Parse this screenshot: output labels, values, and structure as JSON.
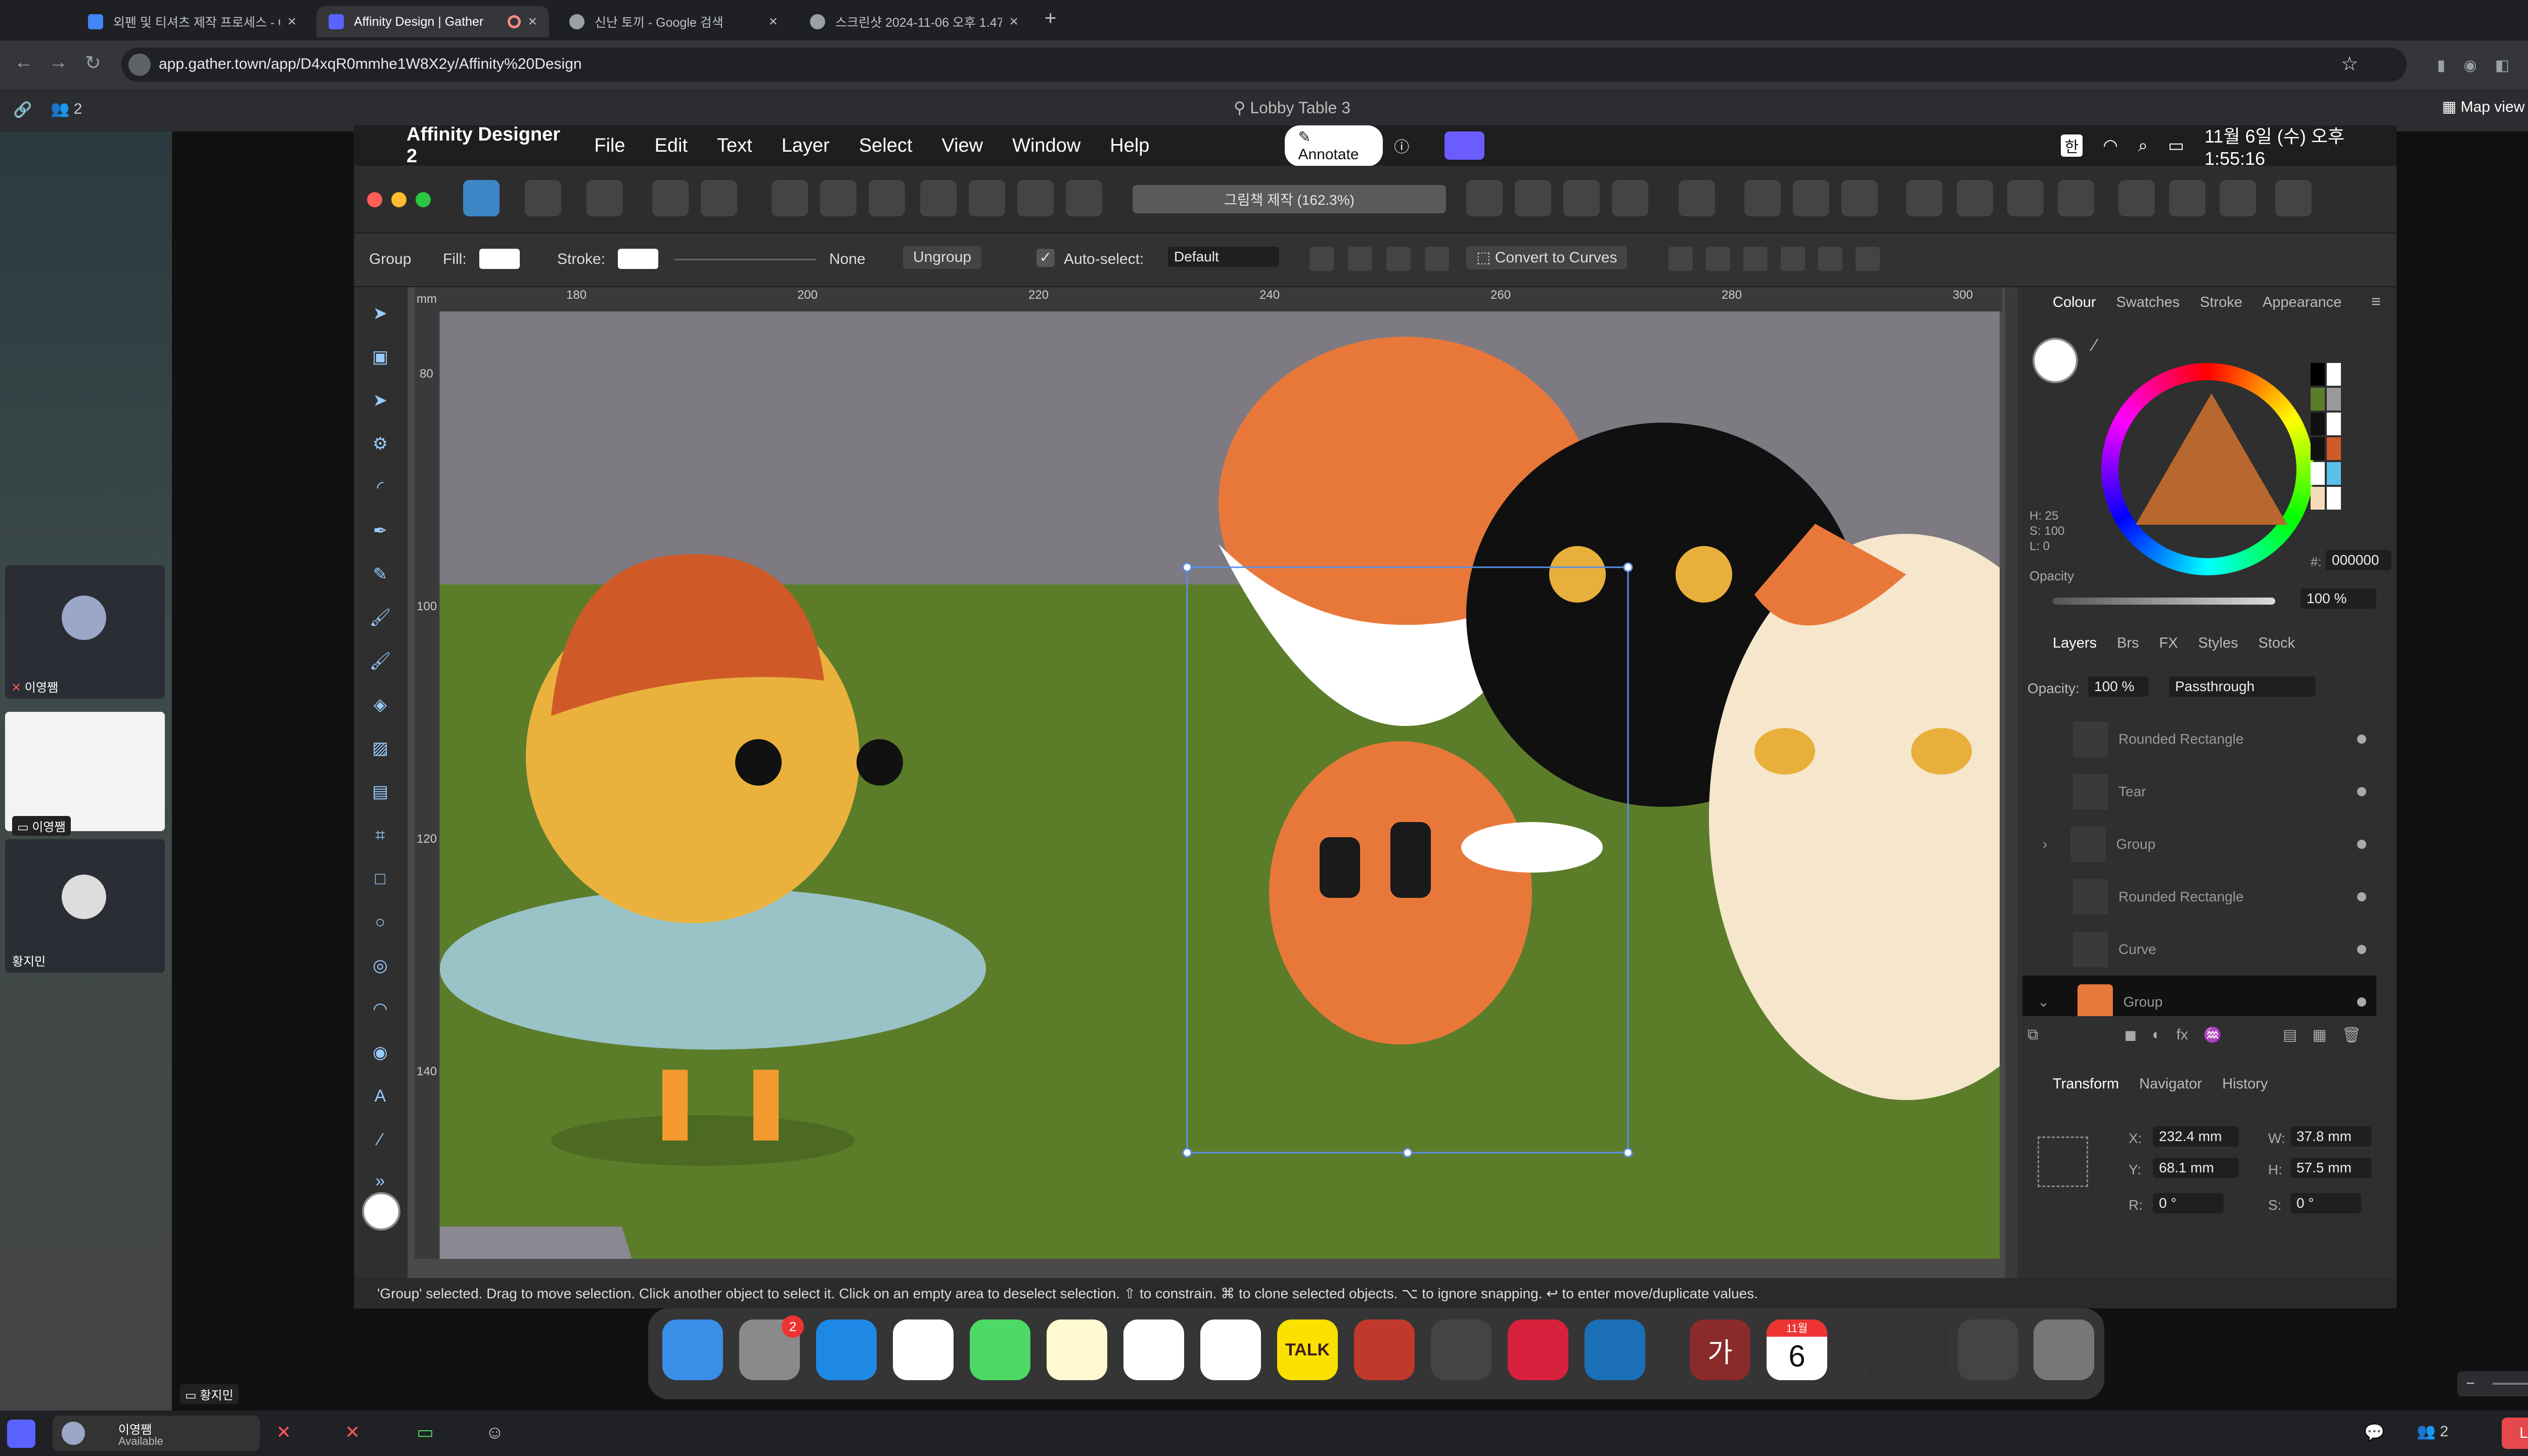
{
  "browser": {
    "tabs": [
      {
        "title": "외펜 및 티셔츠 제작 프로세스 - Go",
        "color": "#4285f4"
      },
      {
        "title": "Affinity Design | Gather",
        "color": "#5a63ff"
      },
      {
        "title": "신난 토끼 - Google 검색",
        "color": "#9aa0a6"
      },
      {
        "title": "스크린샷 2024-11-06 오후 1.47",
        "color": "#9aa0a6"
      }
    ],
    "new_tab": "+",
    "close": "×",
    "url": "app.gather.town/app/D4xqR0mmhe1W8X2y/Affinity%20Design"
  },
  "gather": {
    "participants": "2",
    "location": "Lobby Table 3",
    "map_view": "Map view",
    "tiles": [
      {
        "name": "이영쨈"
      },
      {
        "name": "이영쨈"
      },
      {
        "name": "황지민"
      }
    ],
    "bottom_name": "황지민",
    "user": {
      "name": "이영쨈",
      "status": "Available"
    },
    "leave": "Leave",
    "people_count": "2"
  },
  "mac": {
    "app": "Affinity Designer 2",
    "menus": [
      "File",
      "Edit",
      "Text",
      "Layer",
      "Select",
      "View",
      "Window",
      "Help"
    ],
    "annotate": "Annotate",
    "datetime": "11월 6일 (수) 오후 1:55:16",
    "ime": "한"
  },
  "doc": {
    "title": "그림책 제작 (162.3%)"
  },
  "context": {
    "kind": "Group",
    "fill_label": "Fill:",
    "stroke_label": "Stroke:",
    "stroke_value": "None",
    "ungroup": "Ungroup",
    "autoselect": "Auto-select:",
    "autoselect_value": "Default",
    "convert": "Convert to Curves"
  },
  "ruler": {
    "unit": "mm",
    "h_ticks": [
      "180",
      "200",
      "220",
      "240",
      "260",
      "280",
      "300"
    ],
    "v_ticks": [
      "80",
      "100",
      "120",
      "140"
    ]
  },
  "colour_panel": {
    "tabs": [
      "Colour",
      "Swatches",
      "Stroke",
      "Appearance"
    ],
    "h": "H: 25",
    "s": "S: 100",
    "l": "L: 0",
    "hex_label": "#:",
    "hex": "000000",
    "opacity_label": "Opacity",
    "opacity": "100 %"
  },
  "layers_panel": {
    "tabs": [
      "Layers",
      "Brs",
      "FX",
      "Styles",
      "Stock"
    ],
    "opacity_label": "Opacity:",
    "opacity": "100 %",
    "blend": "Passthrough",
    "rows": [
      "Rounded Rectangle",
      "Tear",
      "Group",
      "Rounded Rectangle",
      "Curve",
      "Group"
    ]
  },
  "transform_panel": {
    "tabs": [
      "Transform",
      "Navigator",
      "History"
    ],
    "x_label": "X:",
    "x": "232.4 mm",
    "y_label": "Y:",
    "y": "68.1 mm",
    "w_label": "W:",
    "w": "37.8 mm",
    "h_label": "H:",
    "h": "57.5 mm",
    "r_label": "R:",
    "r": "0 °",
    "s_label": "S:",
    "s": "0 °"
  },
  "status": {
    "text": "'Group' selected. Drag to move selection. Click another object to select it. Click on an empty area to deselect selection. ⇧ to constrain. ⌘ to clone selected objects. ⌥ to ignore snapping. ↩ to enter move/duplicate values."
  },
  "dock": {
    "badge": "2",
    "talk": "TALK",
    "calendar_month": "11월",
    "calendar_day": "6",
    "hangul": "가"
  },
  "icons": {
    "apple": "apple-icon",
    "search": "search-icon",
    "wifi": "wifi-icon",
    "battery": "battery-icon"
  }
}
